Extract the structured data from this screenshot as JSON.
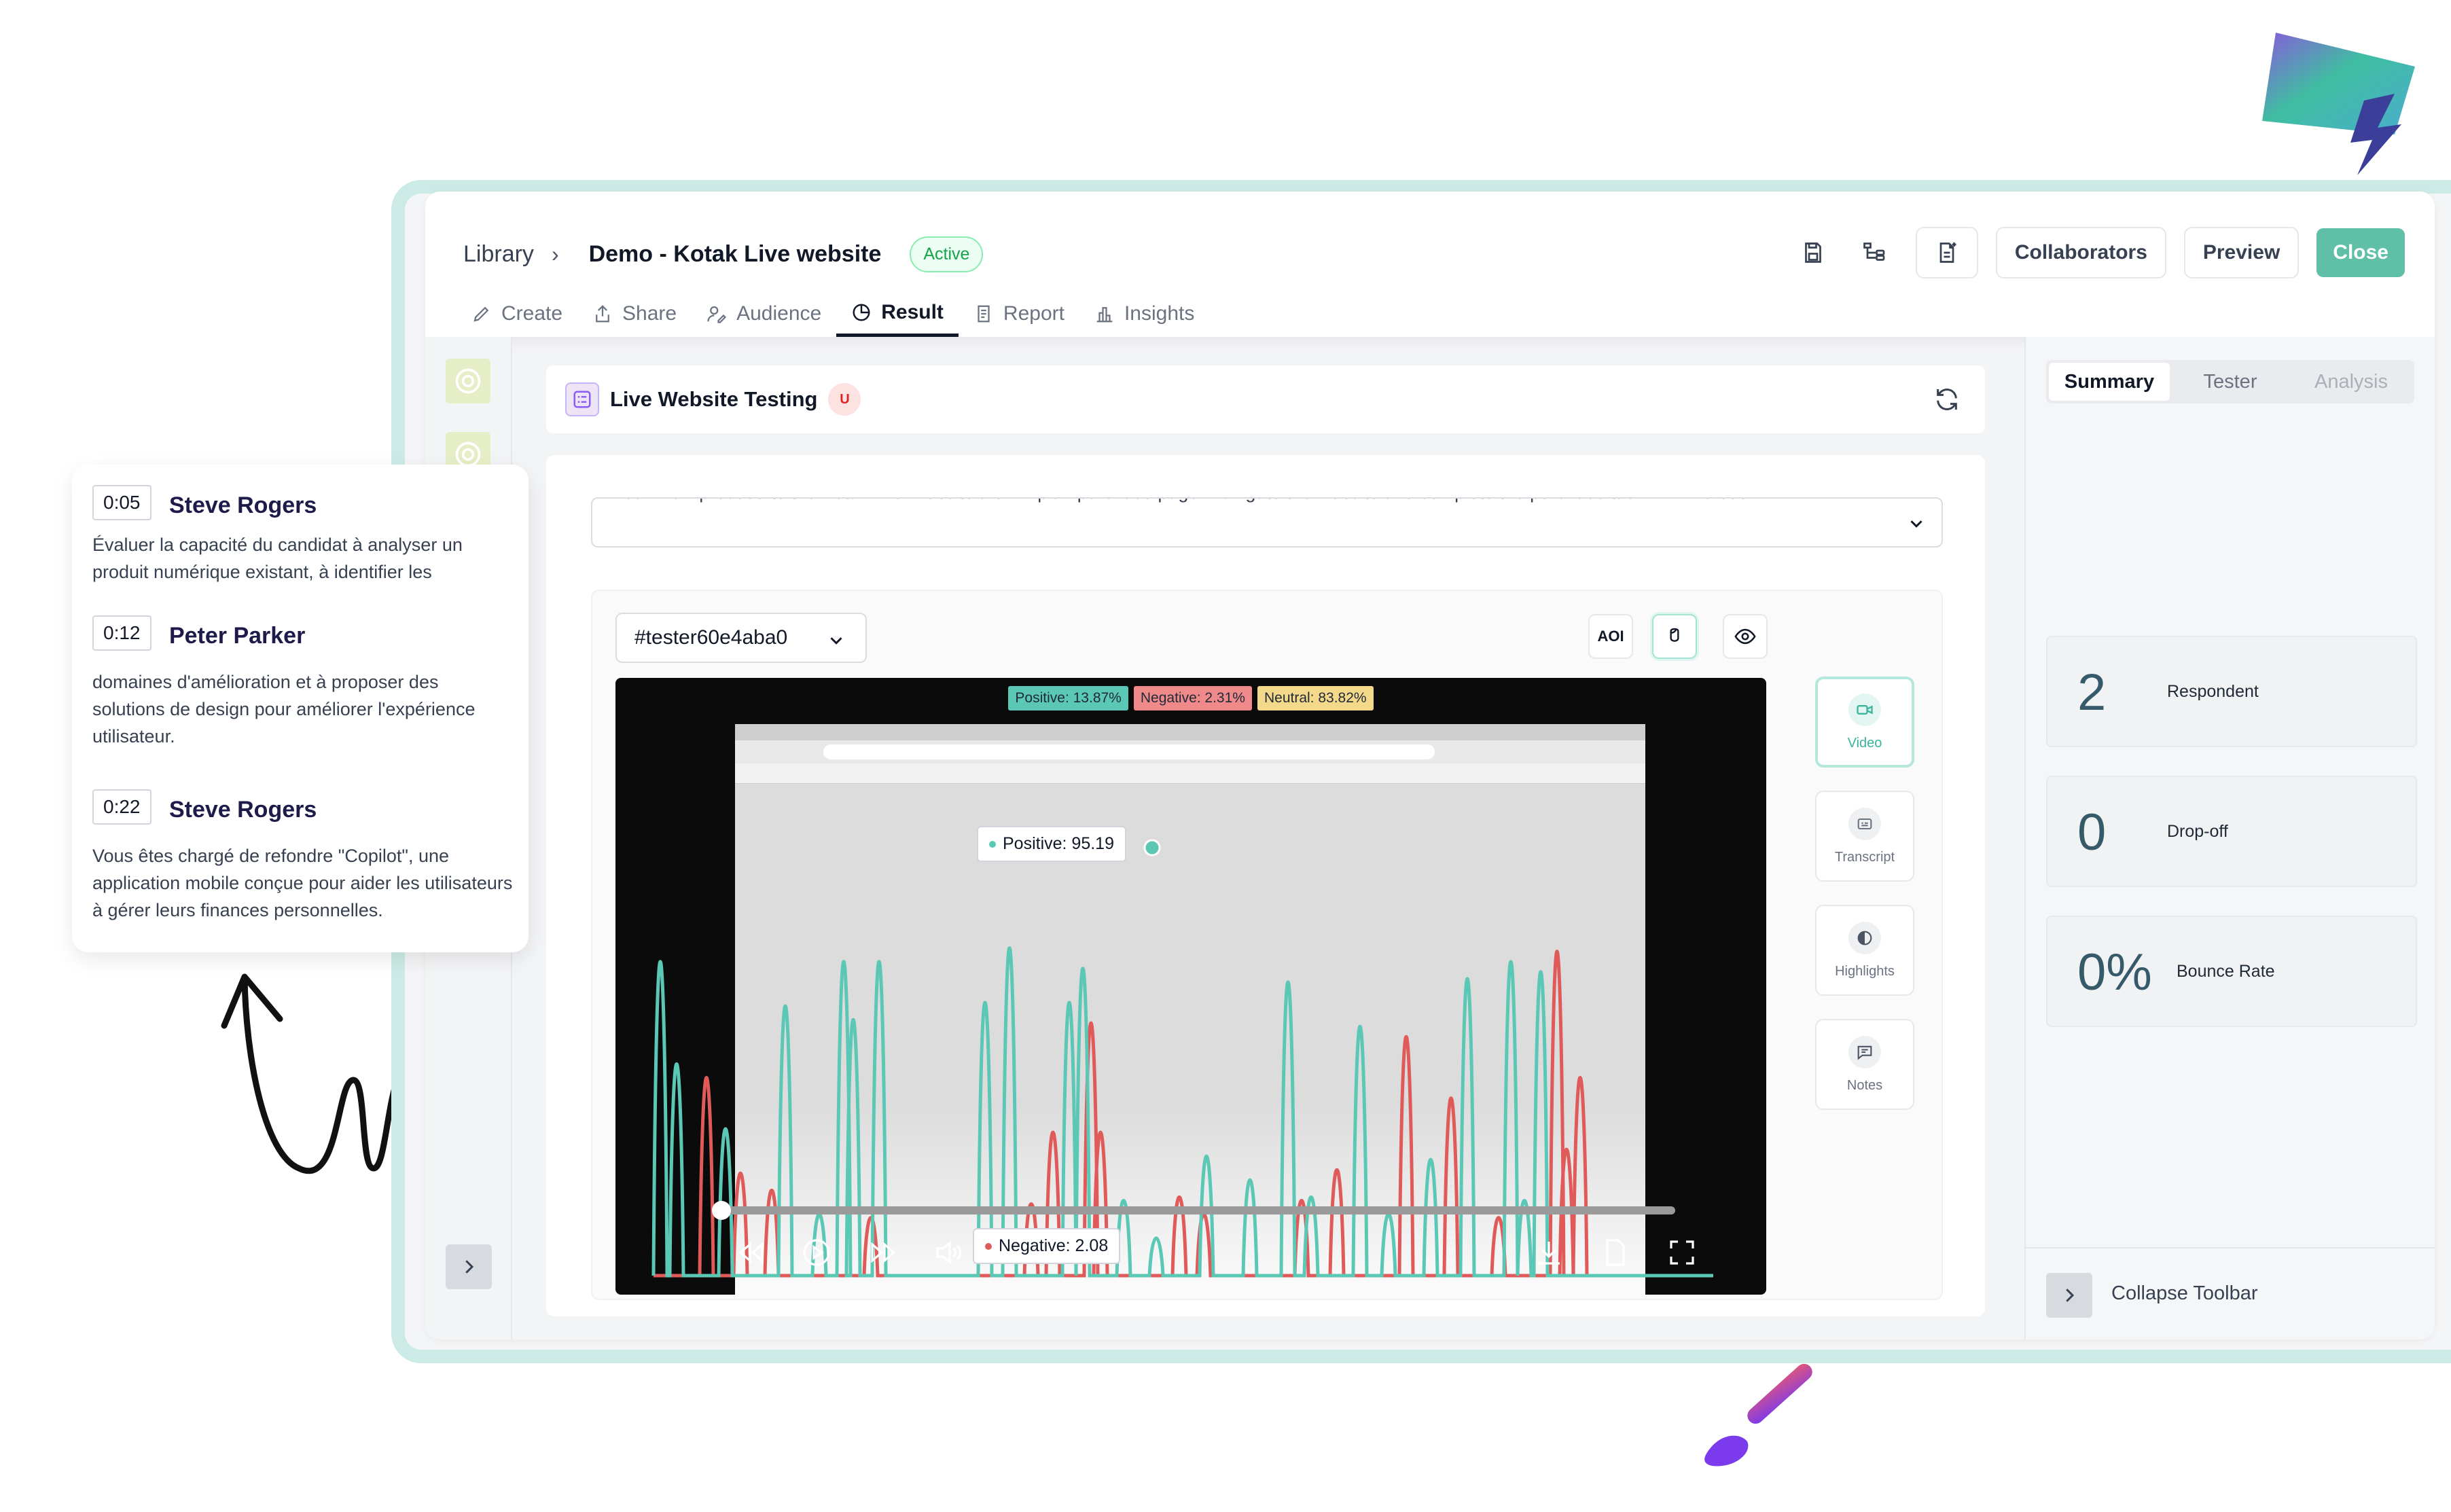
{
  "colors": {
    "accent": "#5fbfa7",
    "positive": "#5ac8b5",
    "negative": "#e05a5a",
    "neutral": "#f5d98a",
    "frame": "#cdebe6"
  },
  "header": {
    "breadcrumb_root": "Library",
    "breadcrumb_sep": "›",
    "title": "Demo - Kotak Live website",
    "status": "Active",
    "icons": [
      "save-icon",
      "flow-icon",
      "add-doc-icon"
    ],
    "collaborators": "Collaborators",
    "preview": "Preview",
    "close": "Close"
  },
  "tabs": [
    {
      "label": "Create",
      "icon": "pencil-icon"
    },
    {
      "label": "Share",
      "icon": "share-icon"
    },
    {
      "label": "Audience",
      "icon": "audience-icon"
    },
    {
      "label": "Result",
      "icon": "pie-icon"
    },
    {
      "label": "Report",
      "icon": "report-icon"
    },
    {
      "label": "Insights",
      "icon": "insights-icon"
    }
  ],
  "section": {
    "title": "Live Website Testing",
    "badge": "U"
  },
  "task": {
    "text": "You'll now proceed to the Kotak Life Website's ULIP plan purchase page. Navigate the website and complete the purchase task. Think aloud."
  },
  "player": {
    "tester": "#tester60e4aba0",
    "aoi_label": "AOI",
    "sentiment": {
      "positive": "Positive:  13.87%",
      "negative": "Negative:  2.31%",
      "neutral": "Neutral:  83.82%"
    },
    "tooltip_positive": "Positive: 95.19",
    "tooltip_negative": "Negative: 2.08",
    "progress": 0.0
  },
  "side_tools": [
    {
      "label": "Video",
      "icon": "video-icon"
    },
    {
      "label": "Transcript",
      "icon": "transcript-icon"
    },
    {
      "label": "Highlights",
      "icon": "highlights-icon"
    },
    {
      "label": "Notes",
      "icon": "notes-icon"
    }
  ],
  "right_panel": {
    "tabs": [
      "Summary",
      "Tester",
      "Analysis"
    ],
    "stats": [
      {
        "value": "2",
        "label": "Respondent"
      },
      {
        "value": "0",
        "label": "Drop-off"
      },
      {
        "value": "0%",
        "label": "Bounce Rate"
      }
    ],
    "collapse": "Collapse Toolbar"
  },
  "transcript": [
    {
      "time": "0:05",
      "name": "Steve Rogers",
      "text": "Évaluer la capacité du candidat à analyser un produit numérique existant, à identifier les"
    },
    {
      "time": "0:12",
      "name": "Peter Parker",
      "text": "domaines d'amélioration et à proposer des solutions de design pour améliorer l'expérience utilisateur."
    },
    {
      "time": "0:22",
      "name": "Steve Rogers",
      "text": "Vous êtes chargé de refondre \"Copilot\", une application mobile conçue pour aider les utilisateurs à gérer leurs finances personnelles."
    }
  ]
}
